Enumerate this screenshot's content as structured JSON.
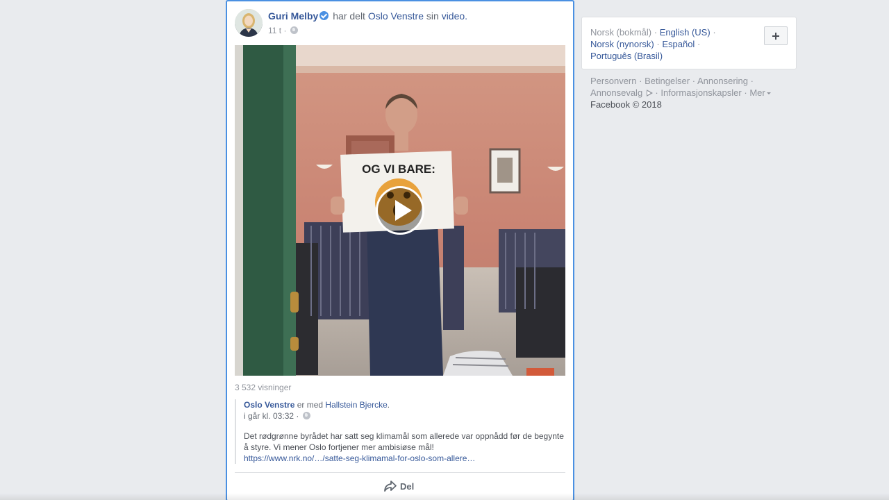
{
  "post": {
    "author": "Guri Melby",
    "shared_text": "har delt",
    "page_name": "Oslo Venstre",
    "sin_text": "sin",
    "video_link": "video",
    "period": ".",
    "time": "11 t",
    "time_sep": "·",
    "views": "3 532 visninger",
    "shared_post": {
      "page": "Oslo Venstre",
      "with_text": "er med",
      "with_person": "Hallstein Bjercke",
      "period": ".",
      "time": "i går kl. 03:32",
      "time_sep": "·",
      "text": "Det rødgrønne byrådet har satt seg klimamål som allerede var oppnådd før de begynte å styre. Vi mener Oslo fortjener mer ambisiøse mål!",
      "url": "https://www.nrk.no/…/satte-seg-klimamal-for-oslo-som-allere…"
    },
    "video_sign": "OG VI BARE:",
    "share_label": "Del"
  },
  "languages": {
    "current": "Norsk (bokmål)",
    "others": [
      "English (US)",
      "Norsk (nynorsk)",
      "Español",
      "Português (Brasil)"
    ],
    "sep": "·"
  },
  "footer": {
    "links": [
      "Personvern",
      "Betingelser",
      "Annonsering",
      "Annonsevalg",
      "Informasjonskapsler",
      "Mer"
    ],
    "sep": "·",
    "copyright": "Facebook © 2018"
  },
  "colors": {
    "link": "#365899",
    "focus_border": "#4a90e2",
    "background": "#e9ebee"
  },
  "icons": [
    "verified-badge-icon",
    "globe-icon",
    "play-icon",
    "share-arrow-icon",
    "plus-icon",
    "adchoices-icon",
    "caret-down-icon"
  ]
}
